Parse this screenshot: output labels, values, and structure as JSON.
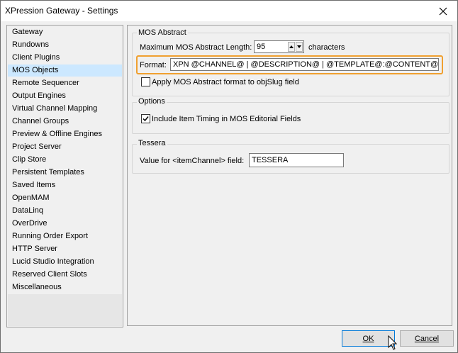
{
  "window": {
    "title": "XPression Gateway - Settings"
  },
  "sidebar": {
    "selected_index": 4,
    "items": [
      "Gateway",
      "Rundowns",
      "Client Plugins",
      "MOS Objects",
      "Remote Sequencer",
      "Output Engines",
      "Virtual Channel Mapping",
      "Channel Groups",
      "Preview & Offline Engines",
      "Project Server",
      "Clip Store",
      "Persistent Templates",
      "Saved Items",
      "OpenMAM",
      "DataLinq",
      "OverDrive",
      "Running Order Export",
      "HTTP Server",
      "Lucid Studio Integration",
      "Reserved Client Slots",
      "Miscellaneous"
    ]
  },
  "mos_abstract": {
    "group_title": "MOS Abstract",
    "max_length_label": "Maximum MOS Abstract Length:",
    "max_length_value": "95",
    "characters_label": "characters",
    "format_label": "Format:",
    "format_value": "XPN @CHANNEL@ | @DESCRIPTION@ | @TEMPLATE@:@CONTENT@",
    "apply_label": "Apply MOS Abstract format to objSlug field",
    "apply_checked": false
  },
  "options": {
    "group_title": "Options",
    "timing_label": "Include Item Timing in MOS Editorial Fields",
    "timing_checked": true
  },
  "tessera": {
    "group_title": "Tessera",
    "channel_label": "Value for <itemChannel> field:",
    "channel_value": "TESSERA"
  },
  "buttons": {
    "ok": "OK",
    "cancel": "Cancel"
  },
  "colors": {
    "selection": "#cce8ff",
    "highlight": "#f0a030",
    "default_button_border": "#0078d7"
  }
}
